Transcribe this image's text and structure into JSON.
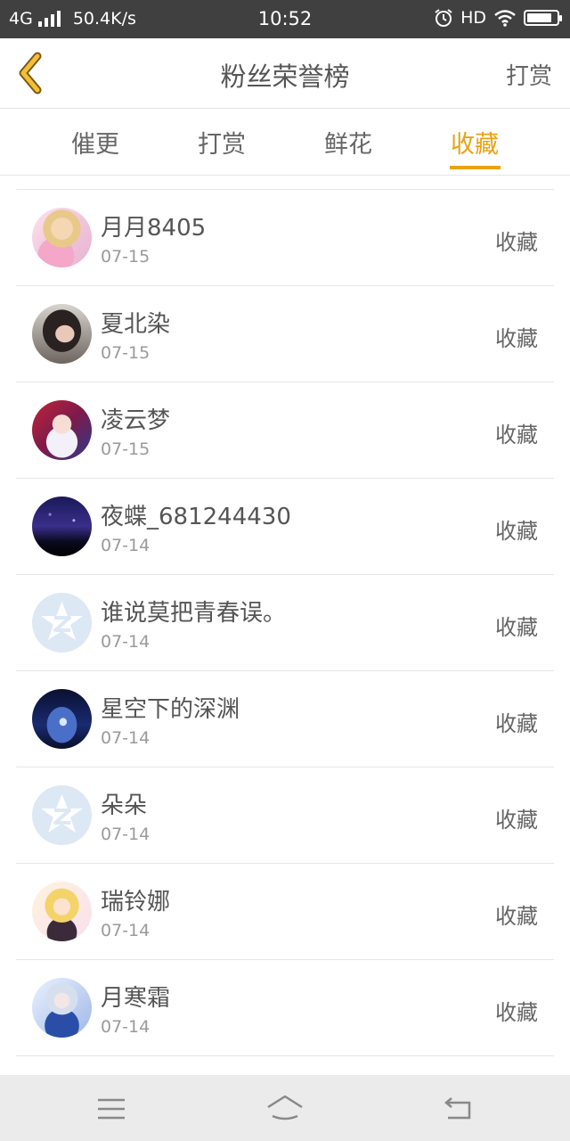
{
  "status_bar": {
    "network": "4G",
    "speed": "50.4K/s",
    "time": "10:52",
    "hd": "HD",
    "battery_level": 0.85,
    "icons": [
      "signal-icon",
      "alarm-icon",
      "wifi-icon",
      "battery-icon"
    ]
  },
  "header": {
    "title": "粉丝荣誉榜",
    "right_action": "打赏",
    "back_icon": "chevron-left-icon",
    "accent_color": "#e8a214"
  },
  "tabs": [
    {
      "label": "催更",
      "active": false
    },
    {
      "label": "打赏",
      "active": false
    },
    {
      "label": "鲜花",
      "active": false
    },
    {
      "label": "收藏",
      "active": true
    }
  ],
  "list": [
    {
      "name": "月月8405",
      "date": "07-15",
      "action": "收藏",
      "avatar": "anime-girl-pink"
    },
    {
      "name": "夏北染",
      "date": "07-15",
      "action": "收藏",
      "avatar": "photo-girl"
    },
    {
      "name": "凌云梦",
      "date": "07-15",
      "action": "收藏",
      "avatar": "anime-girl-red"
    },
    {
      "name": "夜蝶_681244430",
      "date": "07-14",
      "action": "收藏",
      "avatar": "night-sky"
    },
    {
      "name": "谁说莫把青春误。",
      "date": "07-14",
      "action": "收藏",
      "avatar": "default-z-icon"
    },
    {
      "name": "星空下的深渊",
      "date": "07-14",
      "action": "收藏",
      "avatar": "starry-figure"
    },
    {
      "name": "朵朵",
      "date": "07-14",
      "action": "收藏",
      "avatar": "default-z-icon"
    },
    {
      "name": "瑞铃娜",
      "date": "07-14",
      "action": "收藏",
      "avatar": "anime-girl-blonde"
    },
    {
      "name": "月寒霜",
      "date": "07-14",
      "action": "收藏",
      "avatar": "anime-girl-blue"
    }
  ],
  "bottom_nav": [
    "menu-icon",
    "home-icon",
    "back-icon"
  ]
}
